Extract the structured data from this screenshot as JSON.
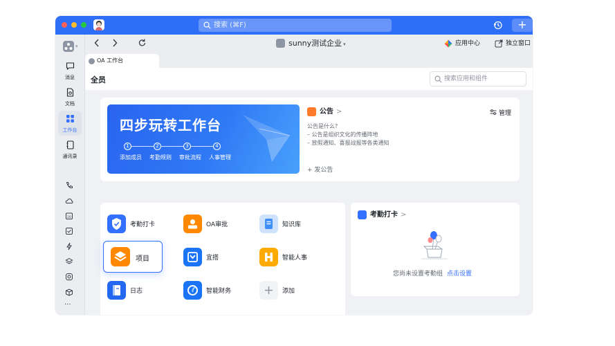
{
  "window": {
    "search_placeholder": "搜索 (⌘F)",
    "plus_label": "+"
  },
  "sidebar": {
    "items": [
      {
        "label": "消息",
        "icon": "message-icon"
      },
      {
        "label": "文档",
        "icon": "document-icon"
      },
      {
        "label": "工作台",
        "icon": "workbench-icon",
        "active": true
      },
      {
        "label": "通讯录",
        "icon": "contacts-icon"
      }
    ],
    "more_label": "···"
  },
  "topnav": {
    "org_name": "sunny测试企业",
    "app_center": "应用中心",
    "detach_window": "独立窗口"
  },
  "tab": {
    "label": "OA 工作台"
  },
  "content": {
    "title": "全员",
    "search_placeholder": "搜索应用和组件"
  },
  "banner": {
    "title": "四步玩转工作台",
    "steps": [
      "1",
      "2",
      "3",
      "4"
    ],
    "step_labels": [
      "添加成员",
      "考勤规则",
      "审批流程",
      "人事管理"
    ]
  },
  "notice": {
    "title": "公告",
    "chevron": ">",
    "manage": "管理",
    "lines": [
      "公告是什么?",
      "– 公告是组织文化的传播阵地",
      "– 放假通知、喜报战报等各类通知"
    ],
    "add": "+ 发公告"
  },
  "apps": [
    {
      "name": "考勤打卡",
      "color": "#3370ff"
    },
    {
      "name": "OA审批",
      "color": "#ff8800"
    },
    {
      "name": "知识库",
      "color": "#3e8ef7"
    },
    {
      "name": "项目",
      "color": "#ff8800"
    },
    {
      "name": "宜搭",
      "color": "#1a74f5"
    },
    {
      "name": "智能人事",
      "color": "#ffaa00"
    },
    {
      "name": "日志",
      "color": "#2468f2"
    },
    {
      "name": "智能财务",
      "color": "#1a74f5"
    },
    {
      "name": "添加",
      "color": "#f2f3f5"
    }
  ],
  "attendance": {
    "title": "考勤打卡",
    "chevron": ">",
    "empty_text": "您尚未设置考勤组",
    "link": "点击设置"
  },
  "colors": {
    "brand": "#2f6ef6",
    "accent": "#3370ff"
  }
}
